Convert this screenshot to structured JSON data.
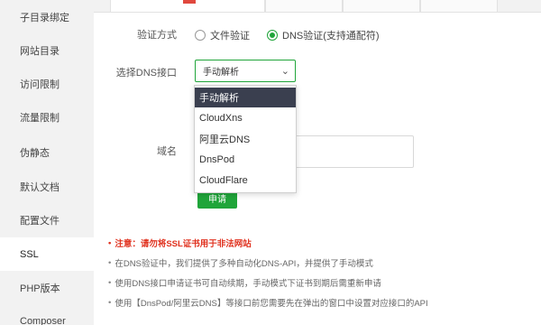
{
  "sidebar": {
    "items": [
      {
        "label": "子目录绑定"
      },
      {
        "label": "网站目录"
      },
      {
        "label": "访问限制"
      },
      {
        "label": "流量限制"
      },
      {
        "label": "伪静态"
      },
      {
        "label": "默认文档"
      },
      {
        "label": "配置文件"
      },
      {
        "label": "SSL"
      },
      {
        "label": "PHP版本"
      },
      {
        "label": "Composer"
      }
    ],
    "active_index": 7
  },
  "form": {
    "verify_label": "验证方式",
    "verify_options": [
      {
        "label": "文件验证",
        "checked": false
      },
      {
        "label": "DNS验证(支持通配符)",
        "checked": true
      }
    ],
    "dns_label": "选择DNS接口",
    "dns_selected": "手动解析",
    "dns_options": [
      "手动解析",
      "CloudXns",
      "阿里云DNS",
      "DnsPod",
      "CloudFlare"
    ],
    "domain_label": "域名",
    "apply_label": "申请"
  },
  "notes": {
    "warning": "注意：请勿将SSL证书用于非法网站",
    "items": [
      "在DNS验证中，我们提供了多种自动化DNS-API，并提供了手动模式",
      "使用DNS接口申请证书可自动续期，手动模式下证书到期后需重新申请",
      "使用【DnsPod/阿里云DNS】等接口前您需要先在弹出的窗口中设置对应接口的API"
    ]
  },
  "colors": {
    "accent": "#20a53a",
    "warning": "#e0321f",
    "dropdown_selected_bg": "#3a3f4f"
  },
  "icons": {
    "select_chevron": "chevron-down-icon"
  }
}
